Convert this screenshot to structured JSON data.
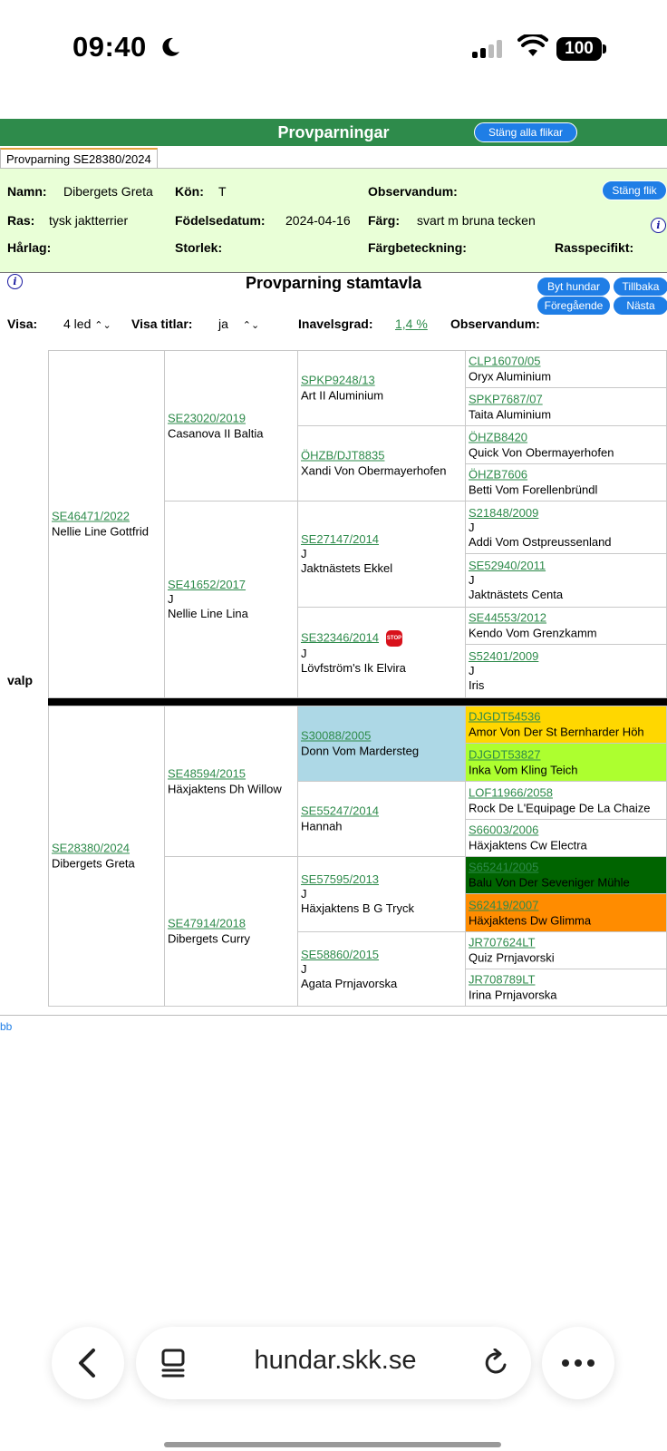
{
  "status_bar": {
    "time": "09:40",
    "battery": "100"
  },
  "header": {
    "title": "Provparningar",
    "close_all": "Stäng alla flikar"
  },
  "tab": {
    "label": "Provparning SE28380/2024"
  },
  "info": {
    "close_tab": "Stäng flik",
    "namn_label": "Namn:",
    "namn": "Dibergets Greta",
    "kon_label": "Kön:",
    "kon": "T",
    "observandum_label": "Observandum:",
    "ras_label": "Ras:",
    "ras": "tysk jaktterrier",
    "fodelse_label": "Födelsedatum:",
    "fodelse": "2024-04-16",
    "farg_label": "Färg:",
    "farg": "svart m bruna tecken",
    "harlag_label": "Hårlag:",
    "storlek_label": "Storlek:",
    "fargbeteckning_label": "Färgbeteckning:",
    "rasspecifikt_label": "Rasspecifikt:"
  },
  "pedigree_header": {
    "title": "Provparning stamtavla",
    "buttons": {
      "swap": "Byt hundar",
      "back": "Tillbaka",
      "prev": "Föregående",
      "next": "Nästa"
    },
    "visa_label": "Visa:",
    "visa_value": "4 led",
    "titlar_label": "Visa titlar:",
    "titlar_value": "ja",
    "inavel_label": "Inavelsgrad:",
    "inavel_value": "1,4 %",
    "observandum_label": "Observandum:"
  },
  "pedigree": {
    "valp_label": "valp",
    "sire": {
      "reg": "SE46471/2022",
      "name": "Nellie Line Gottfrid"
    },
    "sire_sire": {
      "reg": "SE23020/2019",
      "name": "Casanova II Baltia"
    },
    "sire_dam": {
      "reg": "SE41652/2017",
      "j": "J",
      "name": "Nellie Line Lina"
    },
    "ss_sire": {
      "reg": "SPKP9248/13",
      "name": "Art II Aluminium"
    },
    "ss_dam": {
      "reg": "ÖHZB/DJT8835",
      "name": "Xandi Von Obermayerhofen"
    },
    "sd_sire": {
      "reg": "SE27147/2014",
      "j": "J",
      "name": "Jaktnästets Ekkel"
    },
    "sd_dam": {
      "reg": "SE32346/2014",
      "j": "J",
      "name": "Lövfström's Ik Elvira",
      "stop": "STOP"
    },
    "g4_top": [
      {
        "reg": "CLP16070/05",
        "name": "Oryx Aluminium"
      },
      {
        "reg": "SPKP7687/07",
        "name": "Taita Aluminium"
      },
      {
        "reg": "ÖHZB8420",
        "name": "Quick Von Obermayerhofen"
      },
      {
        "reg": "ÖHZB7606",
        "name": "Betti Vom Forellenbründl"
      },
      {
        "reg": "S21848/2009",
        "j": "J",
        "name": "Addi Vom Ostpreussenland"
      },
      {
        "reg": "SE52940/2011",
        "j": "J",
        "name": "Jaktnästets Centa"
      },
      {
        "reg": "SE44553/2012",
        "name": "Kendo Vom Grenzkamm"
      },
      {
        "reg": "S52401/2009",
        "j": "J",
        "name": "Iris"
      }
    ],
    "dam": {
      "reg": "SE28380/2024",
      "name": "Dibergets Greta"
    },
    "dam_sire": {
      "reg": "SE48594/2015",
      "name": "Häxjaktens Dh Willow"
    },
    "dam_dam": {
      "reg": "SE47914/2018",
      "name": "Dibergets Curry"
    },
    "ds_sire": {
      "reg": "S30088/2005",
      "name": "Donn Vom Mardersteg"
    },
    "ds_dam": {
      "reg": "SE55247/2014",
      "name": "Hannah"
    },
    "dd_sire": {
      "reg": "SE57595/2013",
      "j": "J",
      "name": "Häxjaktens B G Tryck"
    },
    "dd_dam": {
      "reg": "SE58860/2015",
      "j": "J",
      "name": "Agata Prnjavorska"
    },
    "g4_bottom": [
      {
        "reg": "DJGDT54536",
        "name": "Amor Von Der St Bernharder Höh"
      },
      {
        "reg": "DJGDT53827",
        "name": "Inka Vom Kling Teich"
      },
      {
        "reg": "LOF11966/2058",
        "name": "Rock De L'Equipage De La Chaize"
      },
      {
        "reg": "S66003/2006",
        "name": "Häxjaktens Cw Electra"
      },
      {
        "reg": "S65241/2005",
        "name": "Balu Von Der Seveniger Mühle"
      },
      {
        "reg": "S62419/2007",
        "name": "Häxjaktens Dw Glimma"
      },
      {
        "reg": "JR707624LT",
        "name": "Quiz Prnjavorski"
      },
      {
        "reg": "JR708789LT",
        "name": "Irina Prnjavorska"
      }
    ],
    "colors": {
      "blue": "#add8e6",
      "gold": "#ffd700",
      "lime": "#adff2f",
      "darkgreen": "#006400",
      "orange": "#ff8c00"
    }
  },
  "footer": {
    "link": "bb"
  },
  "browser": {
    "url": "hundar.skk.se"
  }
}
